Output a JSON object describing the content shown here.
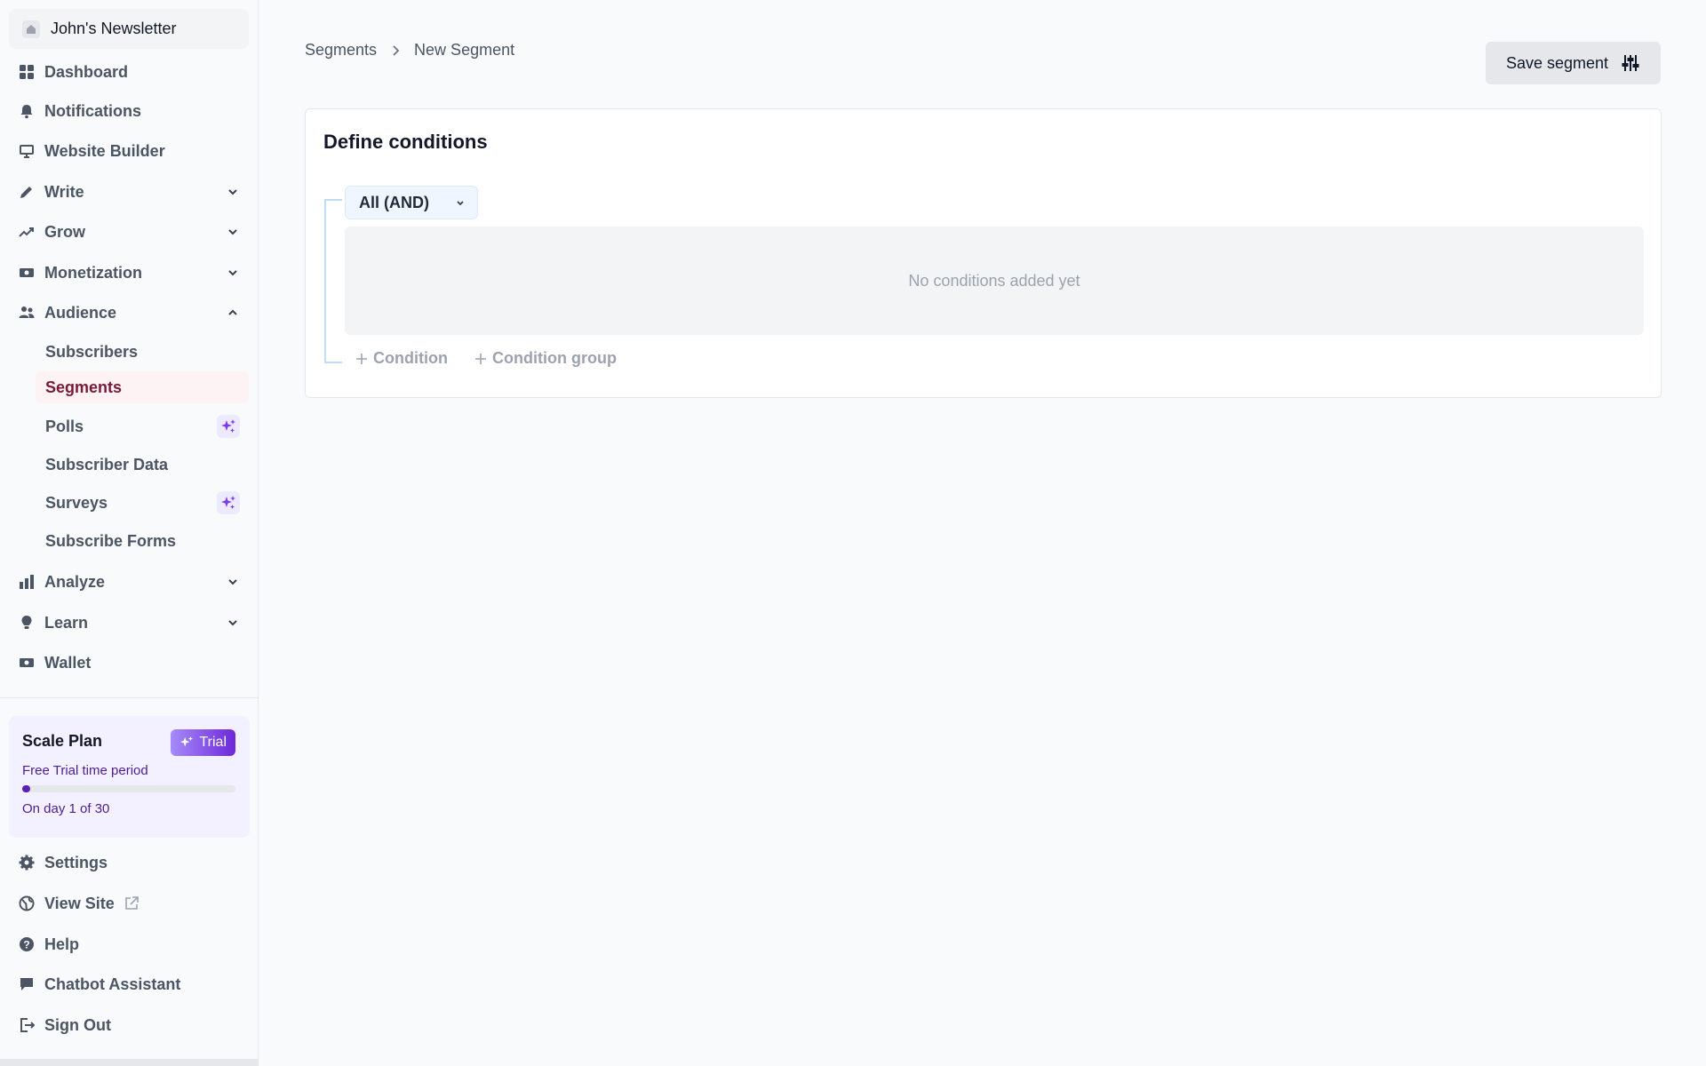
{
  "sidebar": {
    "publication": "John's Newsletter",
    "nav": {
      "dashboard": "Dashboard",
      "notifications": "Notifications",
      "website_builder": "Website Builder",
      "write": "Write",
      "grow": "Grow",
      "monetization": "Monetization",
      "audience": "Audience",
      "analyze": "Analyze",
      "learn": "Learn",
      "wallet": "Wallet"
    },
    "audience_items": {
      "subscribers": "Subscribers",
      "segments": "Segments",
      "polls": "Polls",
      "subscriber_data": "Subscriber Data",
      "surveys": "Surveys",
      "subscribe_forms": "Subscribe Forms"
    },
    "plan": {
      "title": "Scale Plan",
      "badge": "Trial",
      "subtitle": "Free Trial time period",
      "progress": 0.033,
      "days": "On day 1 of 30"
    },
    "footer": {
      "settings": "Settings",
      "view_site": "View Site",
      "help": "Help",
      "chatbot": "Chatbot Assistant",
      "sign_out": "Sign Out"
    }
  },
  "breadcrumb": {
    "parent": "Segments",
    "current": "New Segment"
  },
  "toolbar": {
    "save_label": "Save segment"
  },
  "conditions": {
    "title": "Define conditions",
    "operator": "All (AND)",
    "empty": "No conditions added yet",
    "add_condition": "Condition",
    "add_group": "Condition group"
  },
  "colors": {
    "accent": "#7a1a3b",
    "plan_bg": "#f3f0ff",
    "trial_badge": "#6d28d9"
  }
}
